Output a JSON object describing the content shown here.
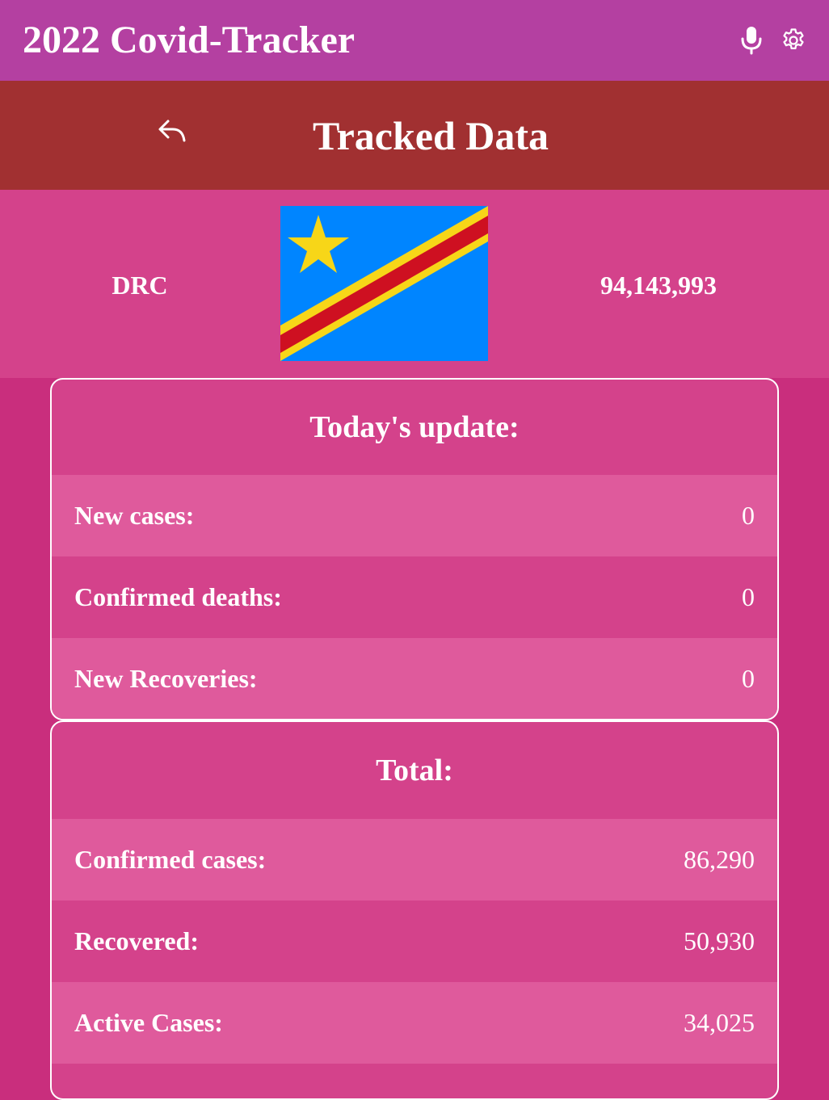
{
  "appbar": {
    "title": "2022 Covid-Tracker",
    "bg_color": "#b440a1",
    "icons": [
      "mic-icon",
      "gear-icon"
    ]
  },
  "subheader": {
    "title": "Tracked Data",
    "bg_color": "#a13031",
    "back_icon": "reply-back-icon"
  },
  "country": {
    "name": "DRC",
    "population": "94,143,993",
    "flag": "flag-democratic-republic-of-the-congo",
    "flag_colors": {
      "field": "#0085ff",
      "star": "#f7d618",
      "stripe": "#ce1021",
      "border": "#f7d618"
    }
  },
  "today": {
    "title": "Today's update:",
    "rows": [
      {
        "label": "New cases:",
        "value": "0"
      },
      {
        "label": "Confirmed deaths:",
        "value": "0"
      },
      {
        "label": "New Recoveries:",
        "value": "0"
      }
    ]
  },
  "total": {
    "title": "Total:",
    "rows": [
      {
        "label": "Confirmed cases:",
        "value": "86,290"
      },
      {
        "label": "Recovered:",
        "value": "50,930"
      },
      {
        "label": "Active Cases:",
        "value": "34,025"
      }
    ]
  },
  "colors": {
    "page_bg": "#c92e7d",
    "band_bg": "#d4428b",
    "row_light": "#df5a9c",
    "text": "#ffffff"
  }
}
